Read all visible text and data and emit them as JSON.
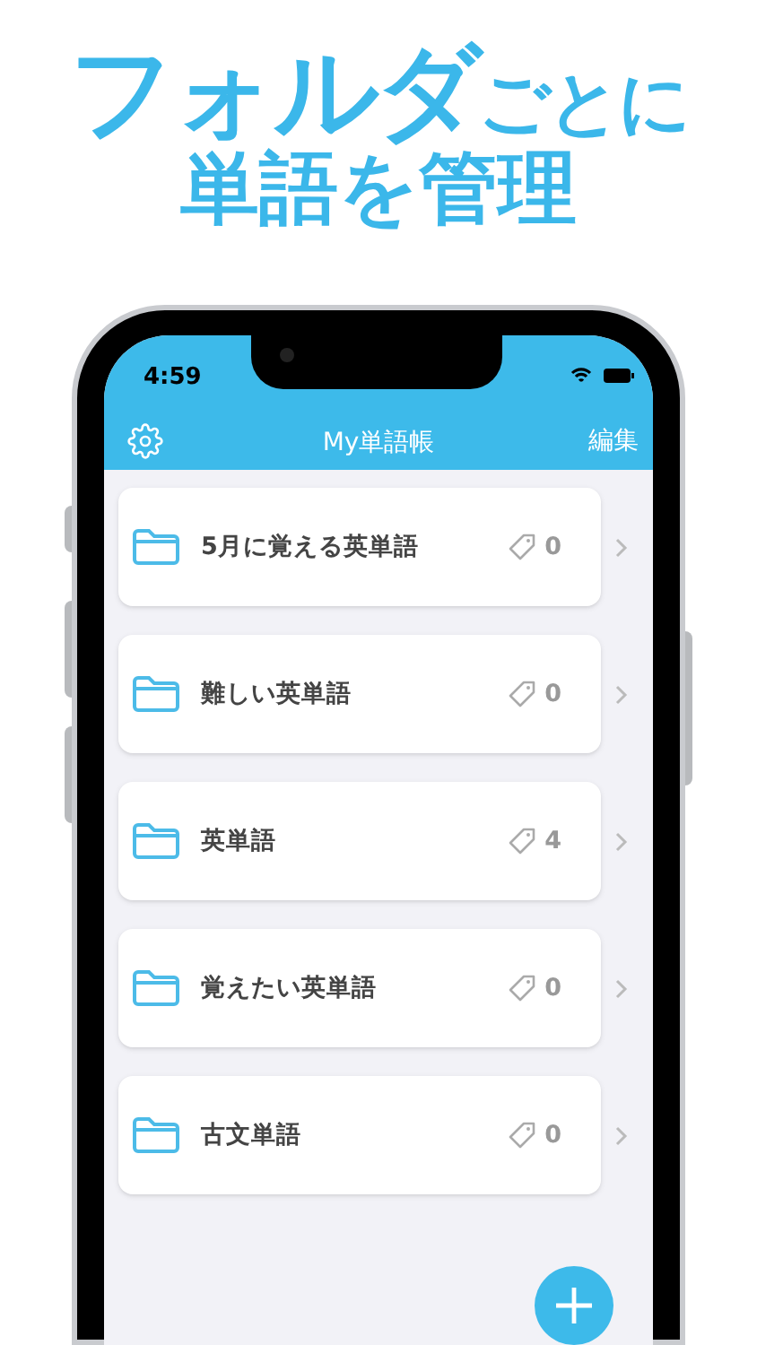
{
  "headline": {
    "large": "フォルダ",
    "small": "ごとに",
    "line2": "単語を管理"
  },
  "status_bar": {
    "time": "4:59"
  },
  "nav": {
    "title": "My単語帳",
    "edit": "編集"
  },
  "folders": [
    {
      "name": "5月に覚える英単語",
      "count": "0"
    },
    {
      "name": "難しい英単語",
      "count": "0"
    },
    {
      "name": "英単語",
      "count": "4"
    },
    {
      "name": "覚えたい英単語",
      "count": "0"
    },
    {
      "name": "古文単語",
      "count": "0"
    }
  ]
}
